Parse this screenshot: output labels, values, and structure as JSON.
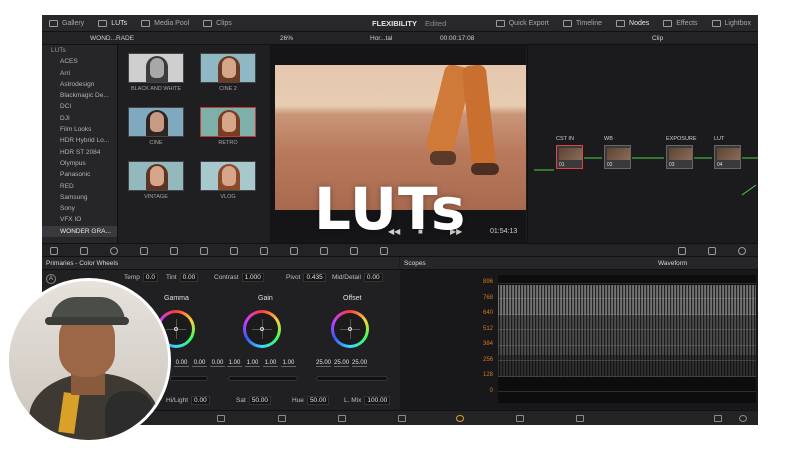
{
  "topbar": {
    "left": [
      "Gallery",
      "LUTs",
      "Media Pool",
      "Clips"
    ],
    "project_title": "FLEXIBILITY",
    "project_status": "Edited",
    "right": [
      "Quick Export",
      "Timeline",
      "Nodes",
      "Effects",
      "Lightbox"
    ]
  },
  "toolbar2": {
    "browser_title": "WOND...RADE",
    "zoom": "26%",
    "clip_name": "Hor...tal",
    "timecode": "00:00:17:08",
    "node_mode": "Clip"
  },
  "lut_sidebar": {
    "root": "LUTs",
    "items": [
      "ACES",
      "Arri",
      "Astrodesign",
      "Blackmagic De...",
      "DCI",
      "DJI",
      "Film Looks",
      "HDR Hybrid Lo...",
      "HDR ST 2084",
      "Olympus",
      "Panasonic",
      "RED",
      "Samsung",
      "Sony",
      "VFX IO",
      "WONDER GRA..."
    ]
  },
  "lut_thumbs": [
    "BLACK AND WHITE",
    "CINE 2",
    "CINE",
    "RETRO",
    "VINTAGE",
    "VLOG"
  ],
  "viewer": {
    "timecode": "01:54:13"
  },
  "nodes": [
    {
      "label": "CST IN",
      "num": "01"
    },
    {
      "label": "WB",
      "num": "02"
    },
    {
      "label": "EXPOSURE",
      "num": "03"
    },
    {
      "label": "LUT",
      "num": "04"
    }
  ],
  "primaries": {
    "title": "Primaries - Color Wheels",
    "badge": "A",
    "params": {
      "temp_label": "Temp",
      "temp": "0.0",
      "tint_label": "Tint",
      "tint": "0.00",
      "contrast_label": "Contrast",
      "contrast": "1.000",
      "pivot_label": "Pivot",
      "pivot": "0.435",
      "middetail_label": "Mid/Detail",
      "middetail": "0.00"
    },
    "wheels": [
      {
        "name": "Gamma",
        "values": [
          "0.00",
          "0.00",
          "0.00"
        ]
      },
      {
        "name": "Gain",
        "values": [
          "1.00",
          "1.00",
          "1.00",
          "1.00"
        ]
      },
      {
        "name": "Offset",
        "values": [
          "25.00",
          "25.00",
          "25.00"
        ]
      }
    ],
    "bottom": {
      "hilight_label": "Hi/Light",
      "hilight": "0.00",
      "sat_label": "Sat",
      "sat": "50.00",
      "hue_label": "Hue",
      "hue": "50.00",
      "lmix_label": "L. Mix",
      "lmix": "100.00"
    }
  },
  "scopes": {
    "title": "Scopes",
    "mode": "Waveform",
    "ticks": [
      "896",
      "768",
      "640",
      "512",
      "384",
      "256",
      "128",
      "0"
    ]
  },
  "overlay": {
    "title": "LUTs"
  }
}
